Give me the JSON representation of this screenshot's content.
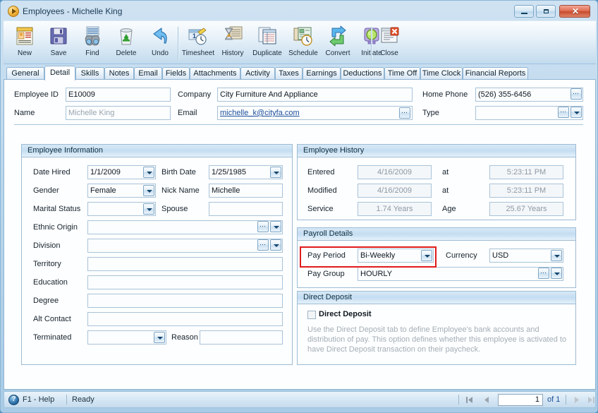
{
  "window": {
    "title": "Employees - Michelle King",
    "title_icon": "app-orb-icon",
    "minimize_label": "",
    "maximize_label": "",
    "close_label": "✕"
  },
  "toolbar": {
    "buttons": [
      {
        "label": "New",
        "icon": "new-document-icon"
      },
      {
        "label": "Save",
        "icon": "floppy-disk-icon"
      },
      {
        "label": "Find",
        "icon": "binoculars-icon"
      },
      {
        "label": "Delete",
        "icon": "recycle-bin-icon"
      },
      {
        "label": "Undo",
        "icon": "undo-arrow-icon"
      },
      {
        "label": "Timesheet",
        "icon": "timesheet-clock-icon"
      },
      {
        "label": "History",
        "icon": "hourglass-history-icon"
      },
      {
        "label": "Duplicate",
        "icon": "duplicate-pages-icon"
      },
      {
        "label": "Schedule",
        "icon": "schedule-calendar-icon"
      },
      {
        "label": "Convert",
        "icon": "convert-arrows-icon"
      },
      {
        "label": "Initiate",
        "icon": "initiate-light-icon"
      },
      {
        "label": "Close",
        "icon": "close-document-icon"
      }
    ]
  },
  "tabs": {
    "active": "Detail",
    "items": [
      {
        "label": "General"
      },
      {
        "label": "Detail"
      },
      {
        "label": "Skills"
      },
      {
        "label": "Notes"
      },
      {
        "label": "Email"
      },
      {
        "label": "Fields"
      },
      {
        "label": "Attachments"
      },
      {
        "label": "Activity"
      },
      {
        "label": "Taxes"
      },
      {
        "label": "Earnings"
      },
      {
        "label": "Deductions"
      },
      {
        "label": "Time Off"
      },
      {
        "label": "Time Clock"
      },
      {
        "label": "Financial Reports"
      }
    ]
  },
  "header_form": {
    "employee_id": {
      "label": "Employee ID",
      "value": "E10009"
    },
    "name": {
      "label": "Name",
      "value": "Michelle King"
    },
    "company": {
      "label": "Company",
      "value": "City Furniture And Appliance"
    },
    "email": {
      "label": "Email",
      "value": "michelle_k@cityfa.com"
    },
    "home_phone": {
      "label": "Home Phone",
      "value": "(526) 355-6456"
    },
    "type": {
      "label": "Type",
      "value": ""
    }
  },
  "employee_information": {
    "title": "Employee Information",
    "date_hired": {
      "label": "Date Hired",
      "value": "1/1/2009"
    },
    "birth_date": {
      "label": "Birth Date",
      "value": "1/25/1985"
    },
    "gender": {
      "label": "Gender",
      "value": "Female"
    },
    "nick_name": {
      "label": "Nick Name",
      "value": "Michelle"
    },
    "marital_status": {
      "label": "Marital Status",
      "value": ""
    },
    "spouse": {
      "label": "Spouse",
      "value": ""
    },
    "ethnic_origin": {
      "label": "Ethnic Origin",
      "value": ""
    },
    "division": {
      "label": "Division",
      "value": ""
    },
    "territory": {
      "label": "Territory",
      "value": ""
    },
    "education": {
      "label": "Education",
      "value": ""
    },
    "degree": {
      "label": "Degree",
      "value": ""
    },
    "alt_contact": {
      "label": "Alt Contact",
      "value": ""
    },
    "terminated": {
      "label": "Terminated",
      "value": ""
    },
    "reason": {
      "label": "Reason",
      "value": ""
    }
  },
  "employee_history": {
    "title": "Employee History",
    "entered": {
      "label": "Entered",
      "value": "4/16/2009"
    },
    "entered_at": {
      "label": "at",
      "value": "5:23:11 PM"
    },
    "modified": {
      "label": "Modified",
      "value": "4/16/2009"
    },
    "modified_at": {
      "label": "at",
      "value": "5:23:11 PM"
    },
    "service": {
      "label": "Service",
      "value": "1.74 Years"
    },
    "age": {
      "label": "Age",
      "value": "25.67 Years"
    }
  },
  "payroll_details": {
    "title": "Payroll Details",
    "pay_period": {
      "label": "Pay Period",
      "value": "Bi-Weekly"
    },
    "currency": {
      "label": "Currency",
      "value": "USD"
    },
    "pay_group": {
      "label": "Pay Group",
      "value": "HOURLY"
    },
    "highlight_color": "#e01b1b"
  },
  "direct_deposit": {
    "title": "Direct Deposit",
    "checkbox_label": "Direct Deposit",
    "checked": false,
    "help_text": "Use the Direct Deposit tab to define Employee's bank accounts and distribution of pay. This option defines whether this employee is activated to have Direct Deposit transaction on their paycheck."
  },
  "status_bar": {
    "help_icon": "help-circle-icon",
    "help_label": "F1 - Help",
    "status": "Ready",
    "nav": {
      "first": "first-record-icon",
      "prev": "previous-record-icon",
      "page_value": "1",
      "of_label": "of 1",
      "next": "next-record-icon",
      "last": "last-record-icon"
    }
  }
}
